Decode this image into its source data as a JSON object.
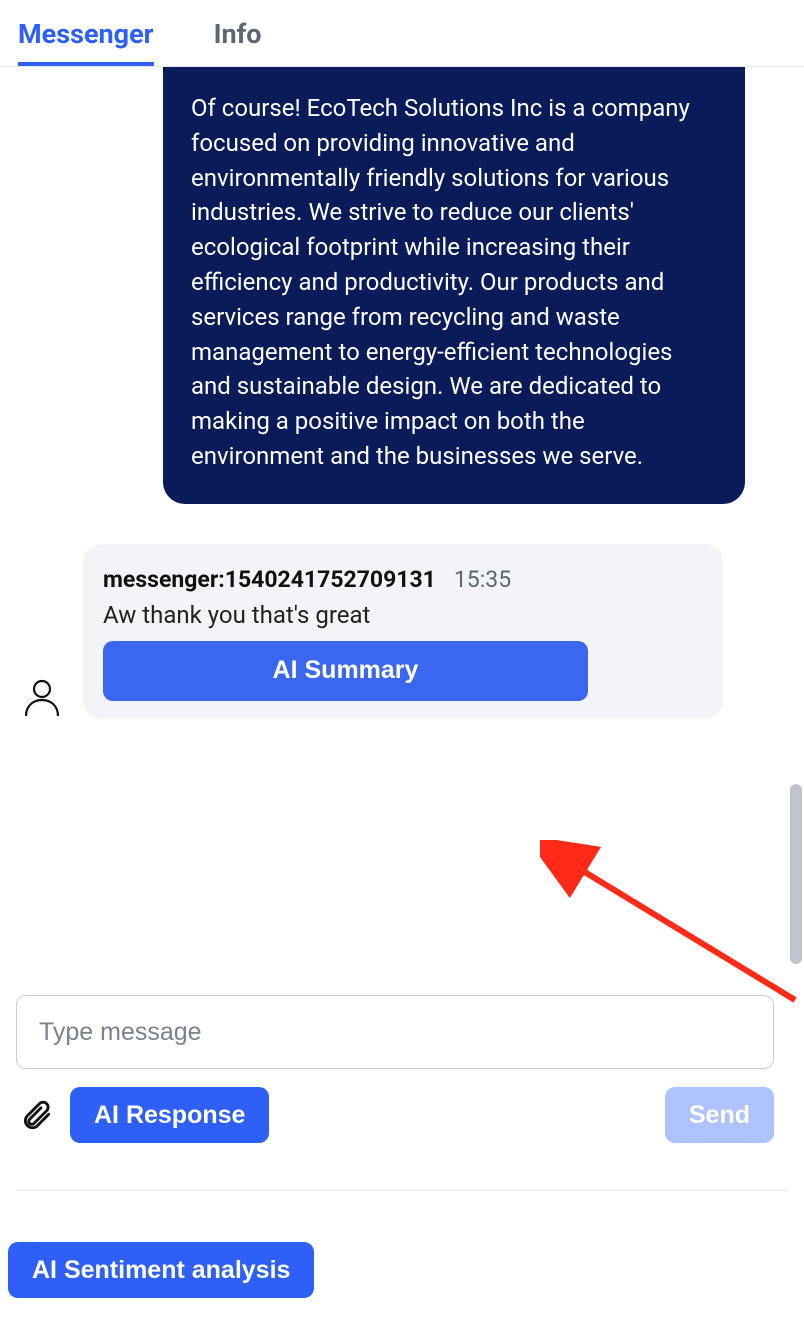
{
  "tabs": {
    "messenger": "Messenger",
    "info": "Info"
  },
  "agent_message": {
    "text": "Of course! EcoTech Solutions Inc is a company focused on providing innovative and environmentally friendly solutions for various industries. We strive to reduce our clients' ecological footprint while increasing their efficiency and productivity. Our products and services range from recycling and waste management to energy-efficient technologies and sustainable design. We are dedicated to making a positive impact on both the environment and the businesses we serve."
  },
  "user_message": {
    "sender": "messenger:1540241752709131",
    "time": "15:35",
    "text": "Aw thank you that's great",
    "ai_summary_label": "AI Summary"
  },
  "compose": {
    "placeholder": "Type message",
    "ai_response_label": "AI Response",
    "send_label": "Send"
  },
  "footer": {
    "sentiment_label": "AI Sentiment analysis"
  },
  "colors": {
    "accent": "#2e5ff6",
    "agent_bubble": "#0a1b59",
    "user_bubble": "#f2f4f7",
    "disabled": "#aec2fb",
    "annotation": "#ff2a17"
  }
}
